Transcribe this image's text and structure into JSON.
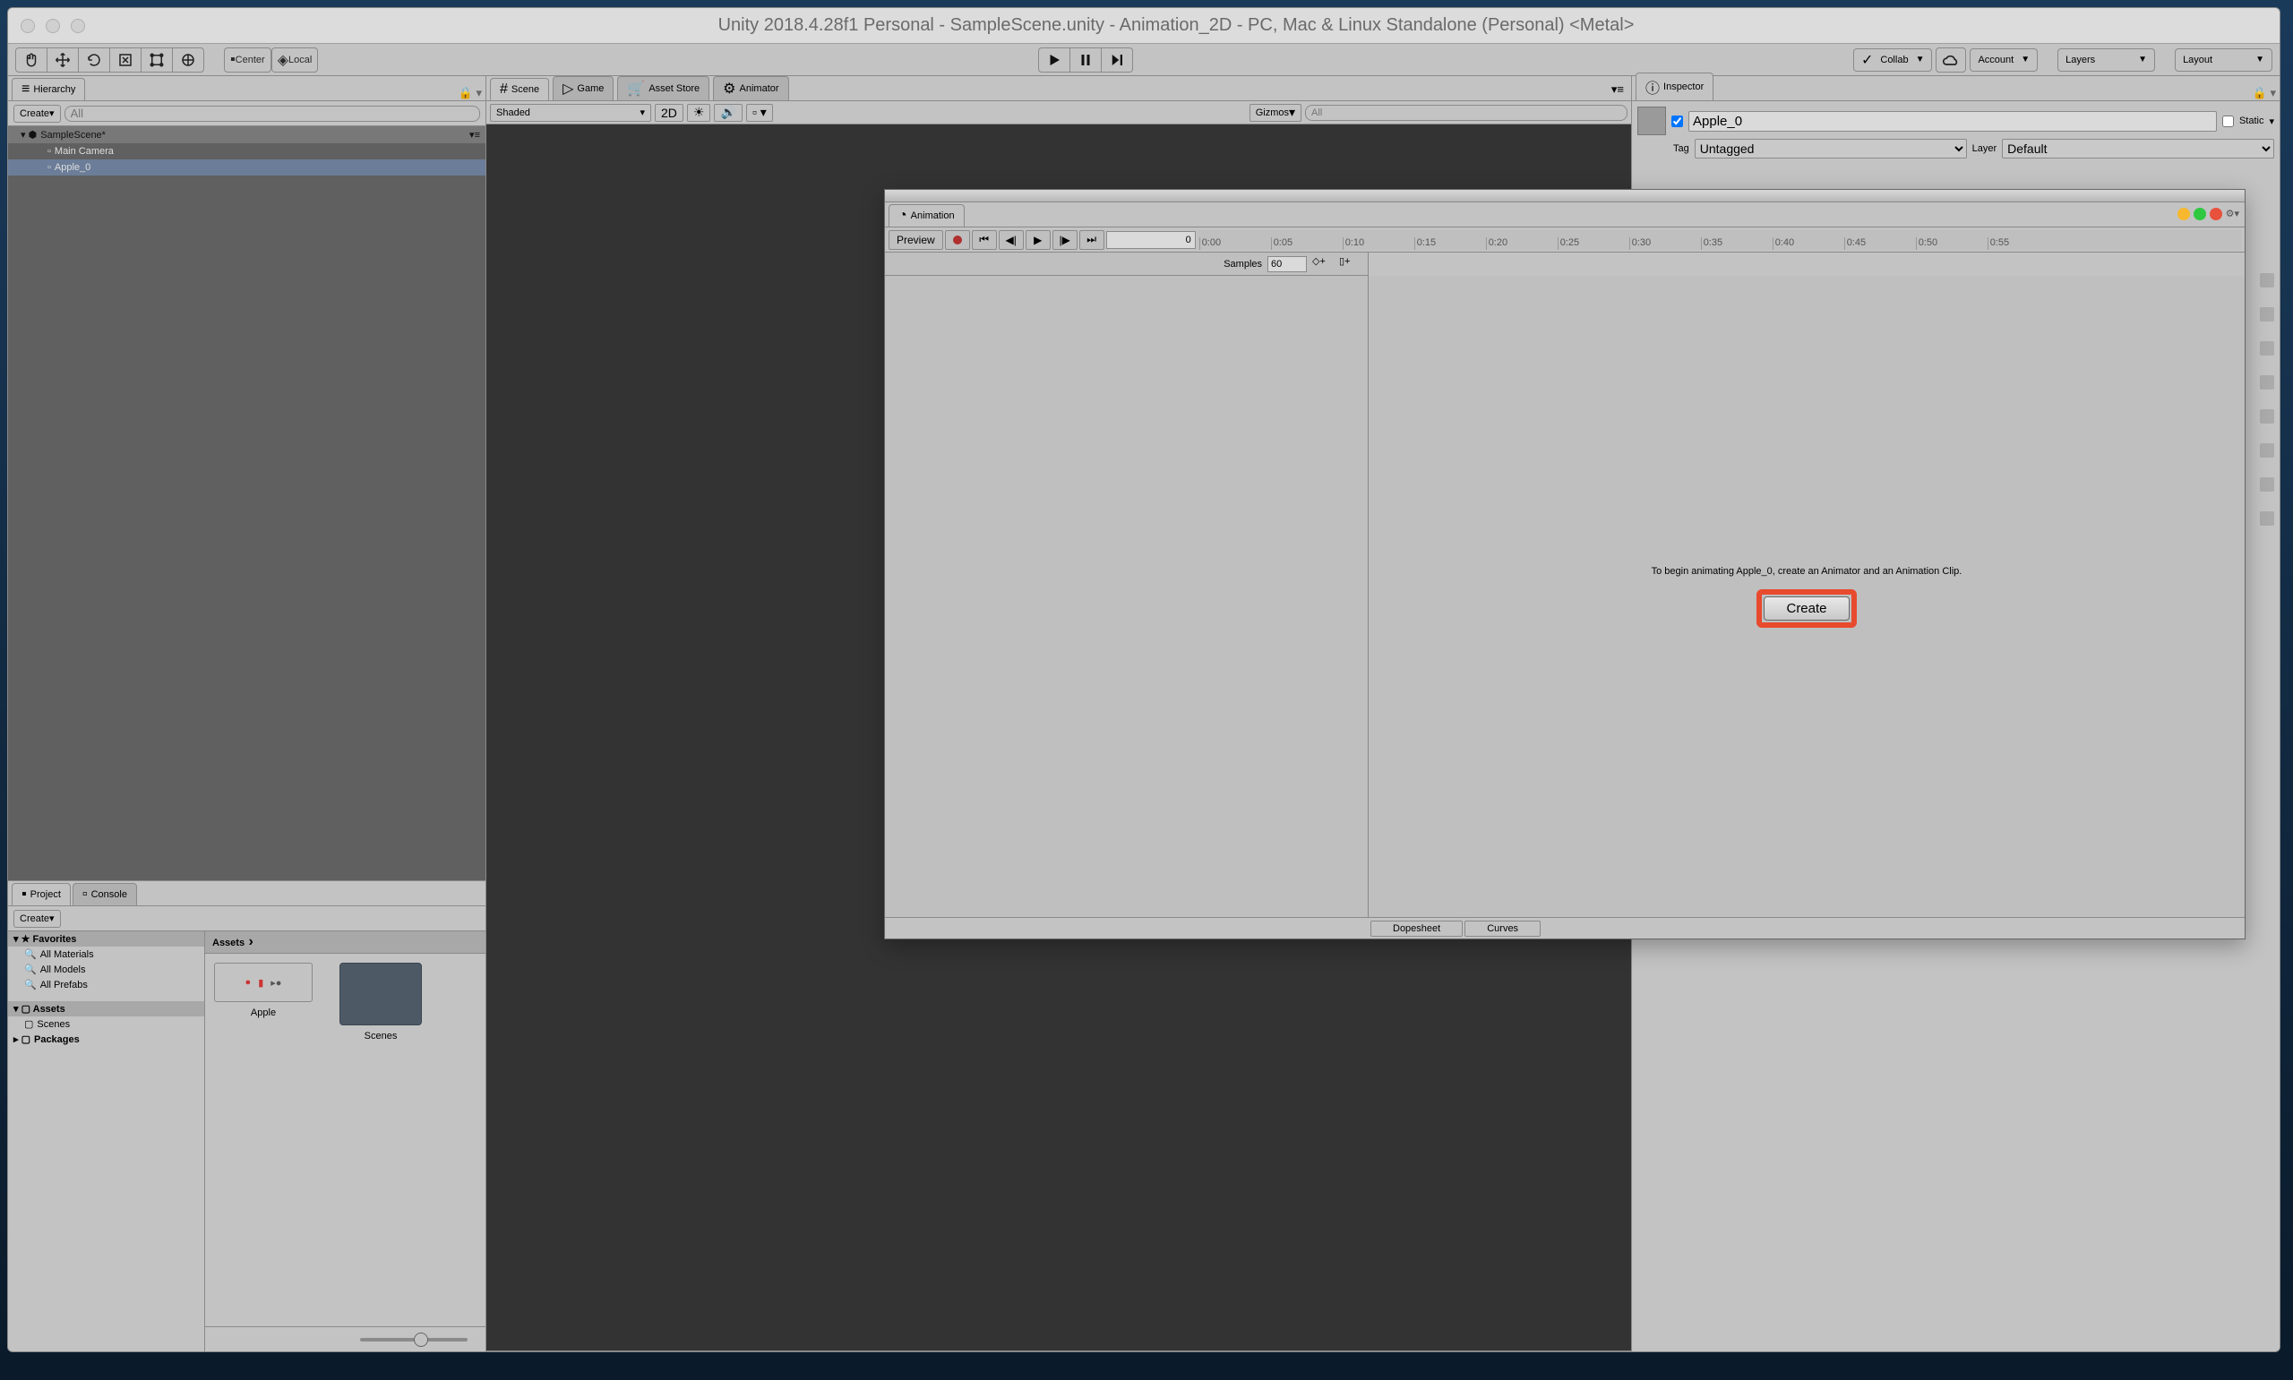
{
  "window": {
    "title": "Unity 2018.4.28f1 Personal - SampleScene.unity - Animation_2D - PC, Mac & Linux Standalone (Personal) <Metal>"
  },
  "toolbar": {
    "center": "Center",
    "local": "Local",
    "collab": "Collab",
    "account": "Account",
    "layers": "Layers",
    "layout": "Layout"
  },
  "hierarchy": {
    "title": "Hierarchy",
    "create": "Create",
    "search_placeholder": "All",
    "scene": "SampleScene*",
    "items": [
      "Main Camera",
      "Apple_0"
    ]
  },
  "sceneTabs": {
    "scene": "Scene",
    "game": "Game",
    "assetStore": "Asset Store",
    "animator": "Animator"
  },
  "sceneBar": {
    "shaded": "Shaded",
    "mode2d": "2D",
    "gizmos": "Gizmos",
    "search_placeholder": "All"
  },
  "inspector": {
    "title": "Inspector",
    "name": "Apple_0",
    "static_label": "Static",
    "tag_label": "Tag",
    "tag_value": "Untagged",
    "layer_label": "Layer",
    "layer_value": "Default"
  },
  "project": {
    "project_tab": "Project",
    "console_tab": "Console",
    "create": "Create",
    "favorites": "Favorites",
    "fav_items": [
      "All Materials",
      "All Models",
      "All Prefabs"
    ],
    "assets_hdr": "Assets",
    "assets_items": [
      "Scenes"
    ],
    "packages": "Packages",
    "breadcrumb": "Assets",
    "asset_apple": "Apple",
    "asset_scenes": "Scenes"
  },
  "animation": {
    "title": "Animation",
    "preview": "Preview",
    "frame_field": "0",
    "samples_label": "Samples",
    "samples_value": "60",
    "ticks": [
      "0:00",
      "0:05",
      "0:10",
      "0:15",
      "0:20",
      "0:25",
      "0:30",
      "0:35",
      "0:40",
      "0:45",
      "0:50",
      "0:55"
    ],
    "message": "To begin animating Apple_0, create an Animator and an Animation Clip.",
    "create_btn": "Create",
    "dopesheet": "Dopesheet",
    "curves": "Curves"
  }
}
